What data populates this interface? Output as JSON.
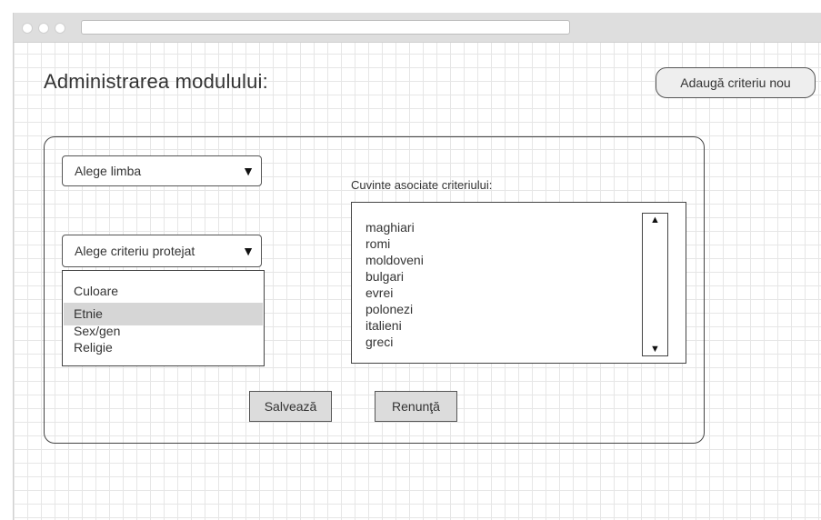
{
  "page": {
    "title": "Administrarea modulului:",
    "add_button_label": "Adaugă criteriu nou"
  },
  "form": {
    "language_select": {
      "selected": "Alege limba"
    },
    "criterion_select": {
      "selected": "Alege criteriu protejat",
      "options": [
        {
          "label": "Culoare",
          "selected": false
        },
        {
          "label": "Etnie",
          "selected": true
        },
        {
          "label": "Sex/gen",
          "selected": false
        },
        {
          "label": "Religie",
          "selected": false
        }
      ]
    },
    "words_label": "Cuvinte asociate criteriului:",
    "words": [
      "maghiari",
      "romi",
      "moldoveni",
      "bulgari",
      "evrei",
      "polonezi",
      "italieni",
      "greci"
    ],
    "save_label": "Salvează",
    "cancel_label": "Renunţă"
  },
  "icons": {
    "dropdown": "▼",
    "scroll_up": "▲",
    "scroll_down": "▼"
  },
  "colors": {
    "selected_option": "#d6d6d6",
    "button_bg": "#dcdcdc",
    "add_button_bg": "#eeeeee"
  }
}
